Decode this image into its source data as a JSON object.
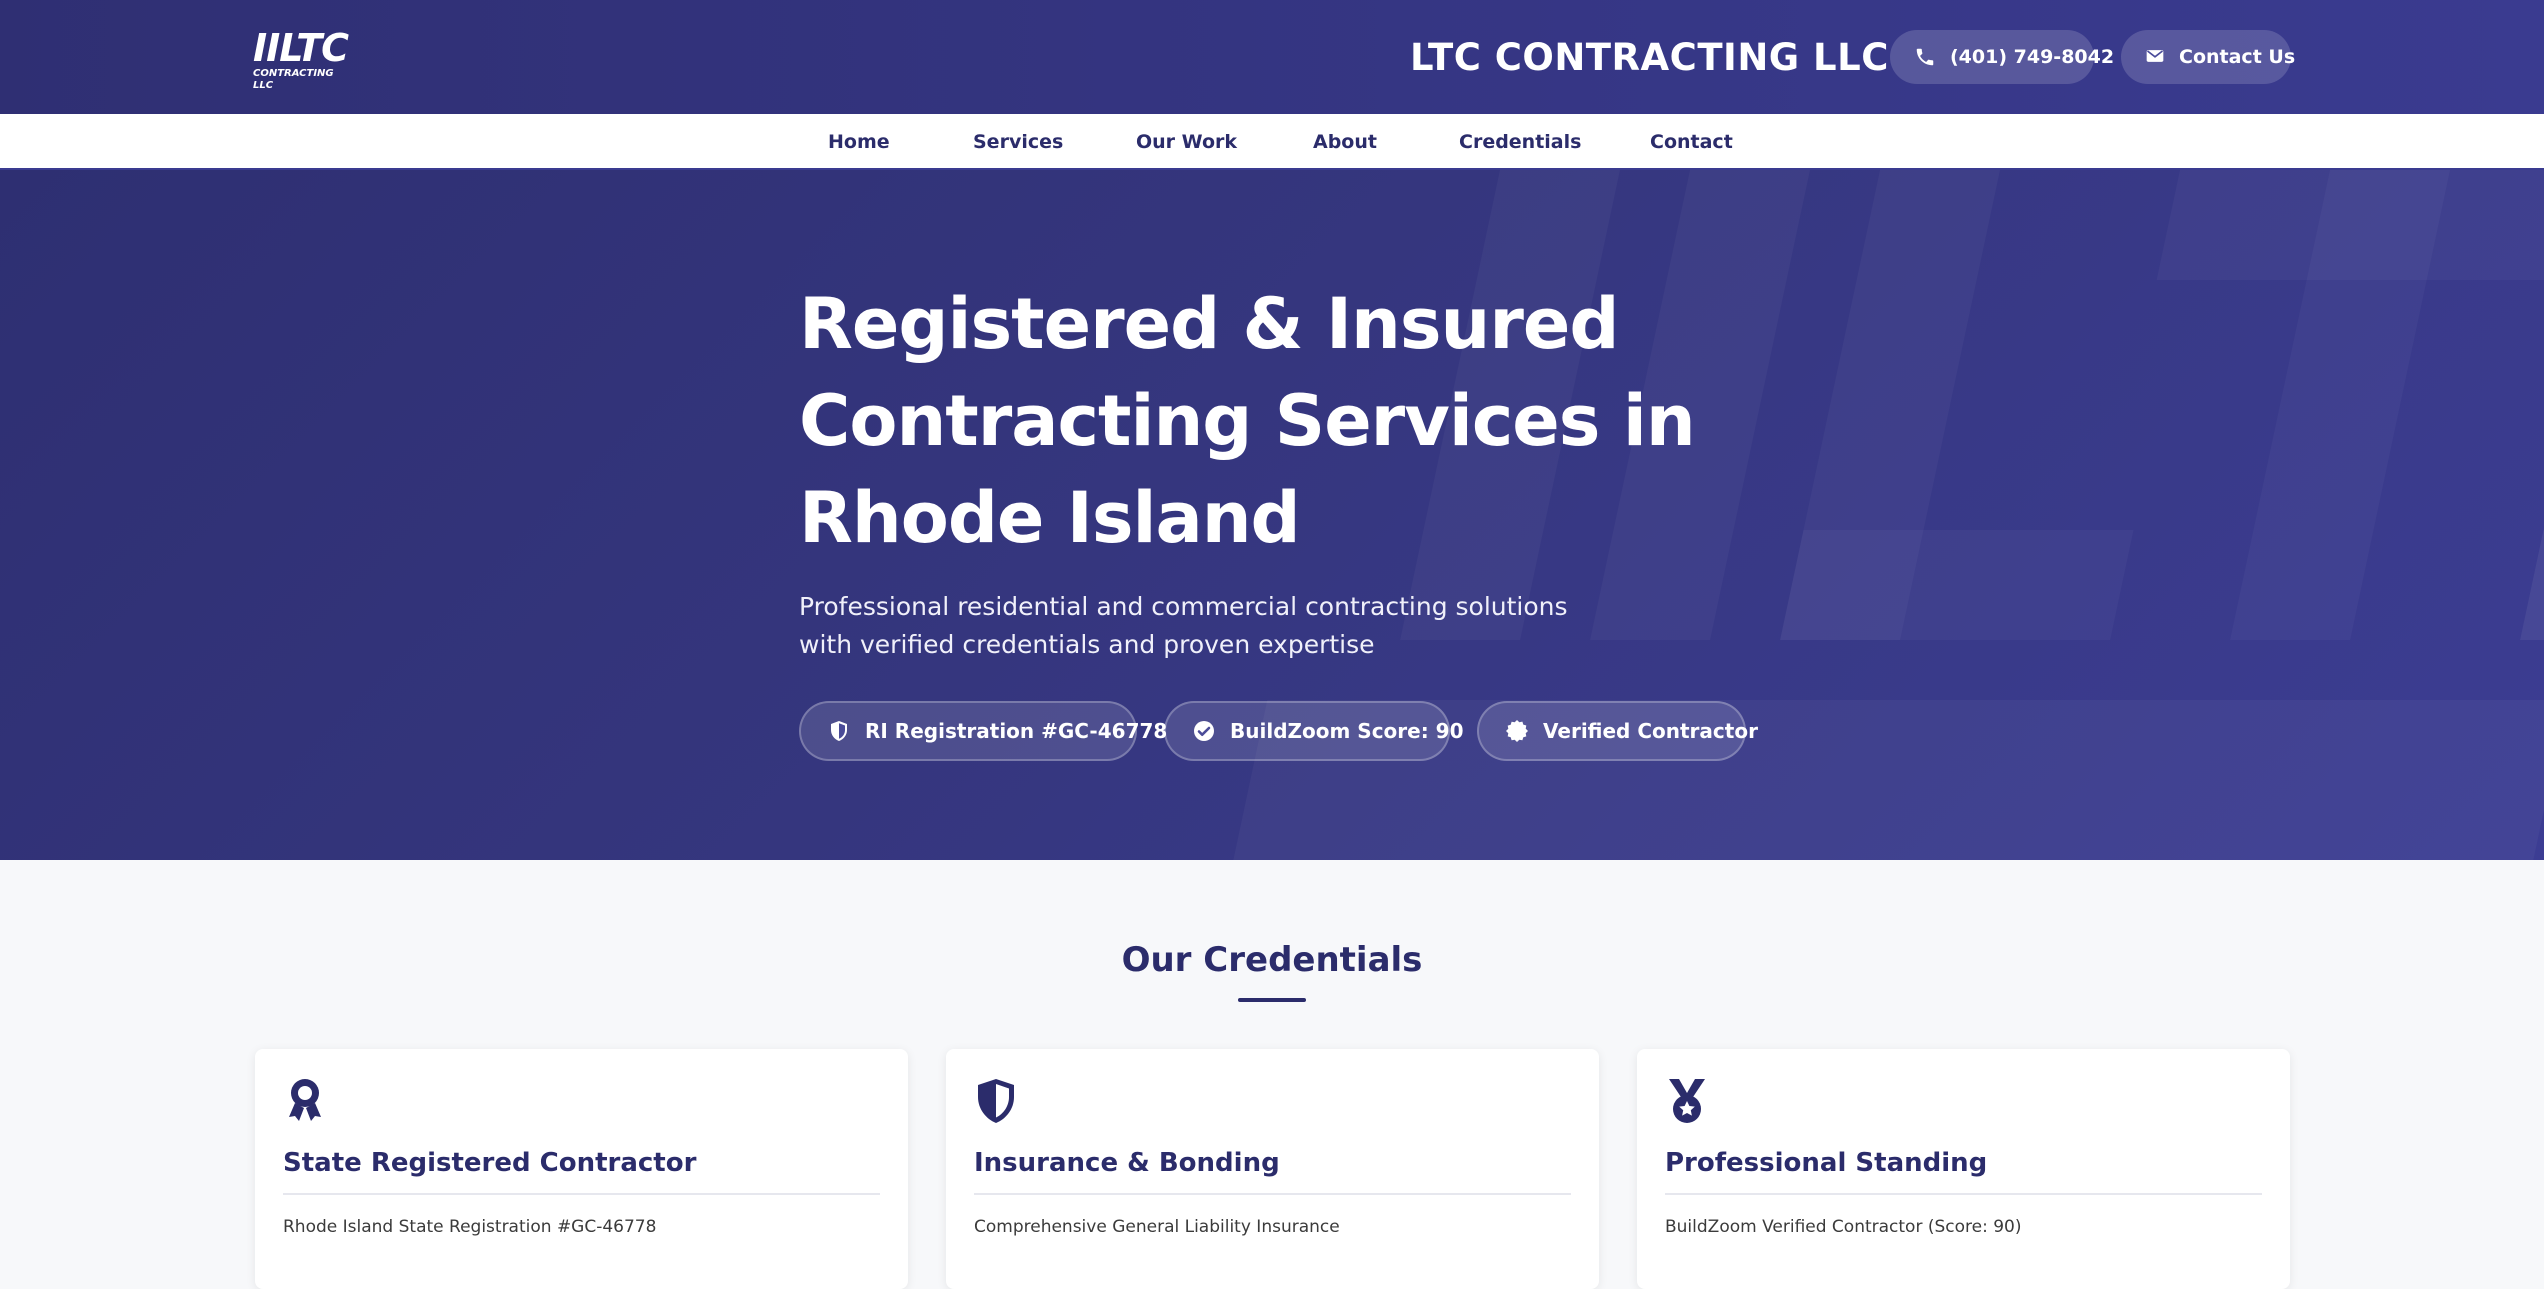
{
  "header": {
    "logo_mark": "IILTC",
    "logo_sub": "CONTRACTING LLC",
    "brand": "LTC CONTRACTING LLC",
    "phone_label": "(401) 749-8042",
    "contact_label": "Contact Us"
  },
  "nav": {
    "items": [
      "Home",
      "Services",
      "Our Work",
      "About",
      "Credentials",
      "Contact"
    ]
  },
  "hero": {
    "title": "Registered & Insured Contracting Services in Rhode Island",
    "lead": "Professional residential and commercial contracting solutions with verified credentials and proven expertise",
    "badges": [
      {
        "label": "RI Registration #GC-46778",
        "icon": "shield-icon"
      },
      {
        "label": "BuildZoom Score: 90",
        "icon": "check-circle-icon"
      },
      {
        "label": "Verified Contractor",
        "icon": "certificate-icon"
      }
    ]
  },
  "credentials": {
    "title": "Our Credentials",
    "cards": [
      {
        "title": "State Registered Contractor",
        "line": "Rhode Island State Registration #GC-46778",
        "icon": "award-icon"
      },
      {
        "title": "Insurance & Bonding",
        "line": "Comprehensive General Liability Insurance",
        "icon": "shield-icon"
      },
      {
        "title": "Professional Standing",
        "line": "BuildZoom Verified Contractor (Score: 90)",
        "icon": "medal-icon"
      }
    ]
  },
  "colors": {
    "primary": "#2f2f73",
    "accent": "#3a3b90",
    "nav_text": "#2b2c6b",
    "background": "#f7f8fa"
  }
}
